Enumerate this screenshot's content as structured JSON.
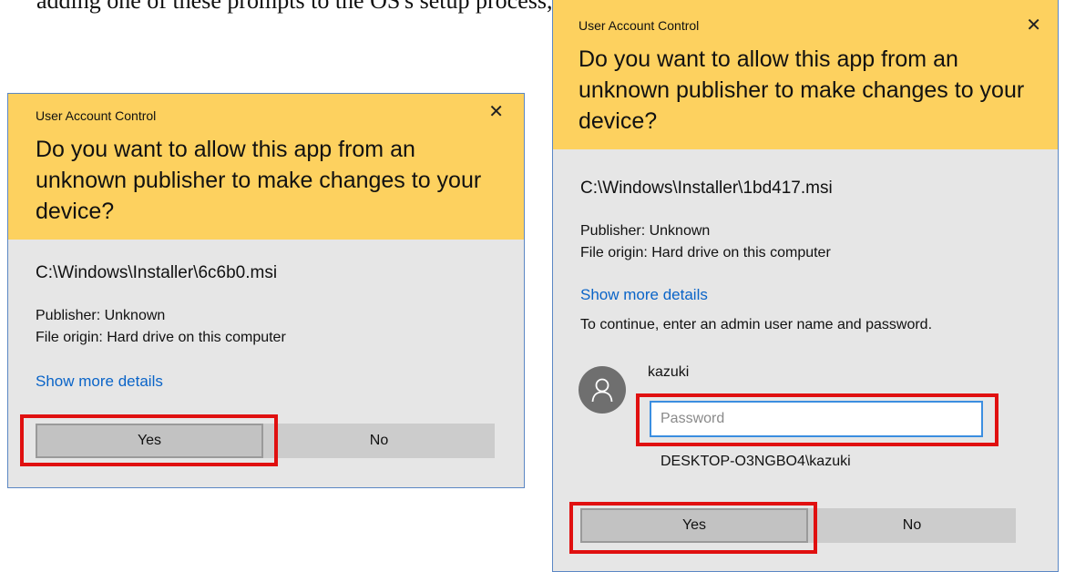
{
  "caption": "adding one of these prompts to the OS's setup process, you'd see:",
  "left_dialog": {
    "title": "User Account Control",
    "close_glyph": "✕",
    "question": "Do you want to allow this app from an unknown publisher to make changes to your device?",
    "file_path": "C:\\Windows\\Installer\\6c6b0.msi",
    "publisher": "Publisher: Unknown",
    "origin": "File origin: Hard drive on this computer",
    "details_link": "Show more details",
    "yes_label": "Yes",
    "no_label": "No"
  },
  "right_dialog": {
    "title": "User Account Control",
    "close_glyph": "✕",
    "question": "Do you want to allow this app from an unknown publisher to make changes to your device?",
    "file_path": "C:\\Windows\\Installer\\1bd417.msi",
    "publisher": "Publisher: Unknown",
    "origin": "File origin: Hard drive on this computer",
    "details_link": "Show more details",
    "admin_prompt": "To continue, enter an admin user name and password.",
    "username": "kazuki",
    "password_placeholder": "Password",
    "domain_user": "DESKTOP-O3NGBO4\\kazuki",
    "avatar_icon": "user-icon",
    "yes_label": "Yes",
    "no_label": "No"
  },
  "colors": {
    "header": "#fdd15f",
    "body": "#e6e6e6",
    "link": "#0a64c8",
    "highlight": "#e01010",
    "border": "#5b87c4"
  }
}
